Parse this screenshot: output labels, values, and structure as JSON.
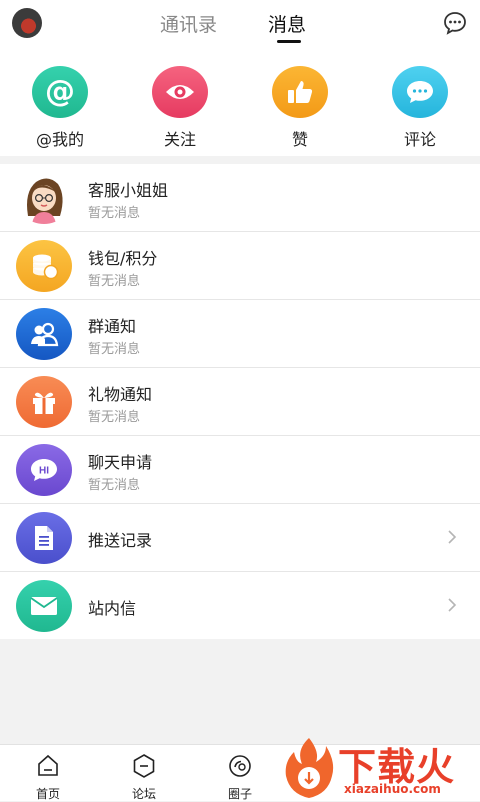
{
  "header": {
    "tabs": [
      {
        "label": "通讯录"
      },
      {
        "label": "消息"
      }
    ]
  },
  "quick_actions": [
    {
      "label": "@我的",
      "icon": "at-icon",
      "color": "#2fc3a0"
    },
    {
      "label": "关注",
      "icon": "eye-icon",
      "color": "#ef4d6f"
    },
    {
      "label": "赞",
      "icon": "thumbs-up-icon",
      "color": "#f5a623"
    },
    {
      "label": "评论",
      "icon": "comment-icon",
      "color": "#3cc4e6"
    }
  ],
  "messages": [
    {
      "title": "客服小姐姐",
      "subtitle": "暂无消息",
      "icon": "customer-service-avatar"
    },
    {
      "title": "钱包/积分",
      "subtitle": "暂无消息",
      "icon": "coins-icon",
      "color": "#f7b733"
    },
    {
      "title": "群通知",
      "subtitle": "暂无消息",
      "icon": "group-icon",
      "color": "#1f6fd6"
    },
    {
      "title": "礼物通知",
      "subtitle": "暂无消息",
      "icon": "gift-icon",
      "color": "#f47a40"
    },
    {
      "title": "聊天申请",
      "subtitle": "暂无消息",
      "icon": "hi-bubble-icon",
      "color": "#7b5bd6"
    }
  ],
  "links": [
    {
      "title": "推送记录",
      "icon": "document-icon",
      "color": "#5a5ed8"
    },
    {
      "title": "站内信",
      "icon": "mail-icon",
      "color": "#2fc3a0"
    }
  ],
  "bottom_nav": [
    {
      "label": "首页",
      "icon": "home-icon"
    },
    {
      "label": "论坛",
      "icon": "forum-icon"
    },
    {
      "label": "圈子",
      "icon": "circle-icon"
    }
  ],
  "watermark": {
    "text": "下载火",
    "url": "xiazaihuo.com"
  }
}
